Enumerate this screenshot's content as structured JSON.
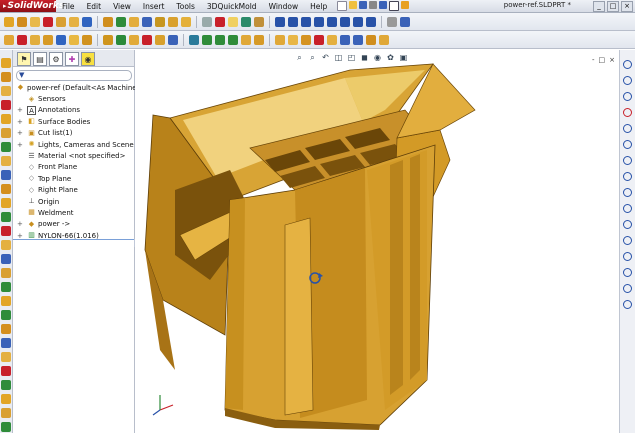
{
  "app": {
    "logo_text": "SolidWorks",
    "document_title": "power-ref.SLDPRT *"
  },
  "menu": [
    "File",
    "Edit",
    "View",
    "Insert",
    "Tools",
    "3DQuickMold",
    "Window",
    "Help"
  ],
  "window_controls": [
    "_",
    "□",
    "×"
  ],
  "feature_tree": {
    "tabs": [
      "feature-manager",
      "property-manager",
      "configuration-manager",
      "dimxpert-manager",
      "display-manager"
    ],
    "root": "power-ref  (Default<As Machined>",
    "items": [
      {
        "label": "Sensors",
        "icon": "sensors-icon",
        "expand": ""
      },
      {
        "label": "Annotations",
        "icon": "annotations-icon",
        "expand": "+"
      },
      {
        "label": "Surface Bodies",
        "icon": "surface-bodies-icon",
        "expand": "+"
      },
      {
        "label": "Cut list(1)",
        "icon": "cut-list-icon",
        "expand": "+"
      },
      {
        "label": "Lights, Cameras and Scene",
        "icon": "lights-icon",
        "expand": "+"
      },
      {
        "label": "Material <not specified>",
        "icon": "material-icon",
        "expand": ""
      },
      {
        "label": "Front Plane",
        "icon": "plane-icon",
        "expand": ""
      },
      {
        "label": "Top Plane",
        "icon": "plane-icon",
        "expand": ""
      },
      {
        "label": "Right Plane",
        "icon": "plane-icon",
        "expand": ""
      },
      {
        "label": "Origin",
        "icon": "origin-icon",
        "expand": ""
      },
      {
        "label": "Weldment",
        "icon": "weldment-icon",
        "expand": ""
      },
      {
        "label": "power ->",
        "icon": "part-icon",
        "expand": "+"
      },
      {
        "label": "NYLON-66(1.016)",
        "icon": "body-icon",
        "expand": "+"
      }
    ]
  },
  "colors": {
    "part_light": "#e3b23d",
    "part_mid": "#c88f1f",
    "part_dark": "#8a5e10",
    "part_shadow": "#5e3e08",
    "accent_red": "#c8202a",
    "toolbar_blue": "#2852a8"
  },
  "viewport_controls": [
    "-",
    "□",
    "×"
  ]
}
